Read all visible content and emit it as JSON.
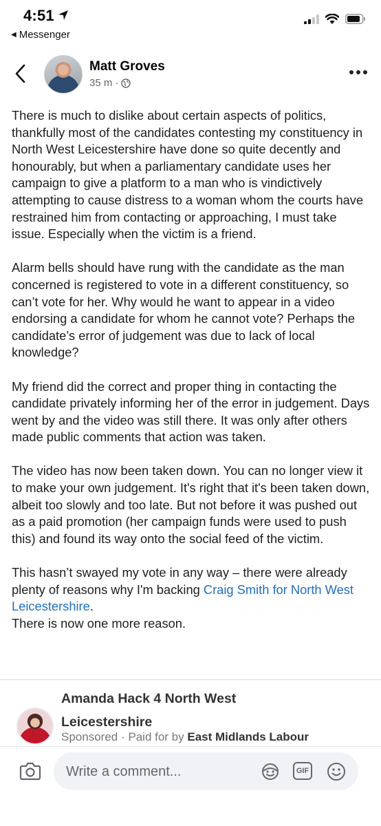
{
  "status_bar": {
    "time": "4:51",
    "back_app": "Messenger"
  },
  "post": {
    "author": "Matt Groves",
    "time": "35 m",
    "separator": "·",
    "paragraphs": [
      "There is much to dislike about certain aspects of politics, thankfully most of the candidates contesting my constituency in North West Leicestershire have done so quite decently and honourably, but when a parliamentary candidate uses her campaign to give a platform to a man who is vindictively attempting to cause distress to a woman whom the courts have restrained him from contacting or approaching, I must take issue. Especially when the victim is a friend.",
      "Alarm bells should have rung with the candidate as the man concerned is registered to vote in a different constituency, so can’t vote for her. Why would he want to appear in a video endorsing a candidate for whom he cannot vote? Perhaps the candidate’s error of judgement was due to lack of local knowledge?",
      "My friend did the correct and proper thing in contacting the candidate privately informing her of the error in judgement. Days went by and the video was still there. It was only after others made public comments that action was taken.",
      "The video has now been taken down. You can no longer view it to make your own judgement. It's right that it's been taken down, albeit too slowly and too late. But not before it was pushed out as a paid promotion (her campaign funds were used to push this) and found its way onto the social feed of the victim."
    ],
    "last_para_before": "This hasn’t swayed my vote in any way – there were already plenty of reasons why I'm backing ",
    "last_para_link": "Craig Smith for North West Leicestershire",
    "last_para_after": ".",
    "closing_line": "There is now one more reason."
  },
  "sponsored": {
    "page_name": "Amanda Hack 4 North West Leicestershire",
    "label": "Sponsored",
    "separator": "·",
    "paid_for_prefix": "Paid for by",
    "funder": "East Midlands Labour"
  },
  "comment_bar": {
    "placeholder": "Write a comment...",
    "gif_label": "GIF"
  },
  "icons": {
    "location": "location-arrow-icon",
    "signal": "signal-icon",
    "wifi": "wifi-icon",
    "battery": "battery-icon",
    "back": "chevron-left-icon",
    "globe": "globe-icon",
    "more": "more-horizontal-icon",
    "camera": "camera-icon",
    "avatar_sticker": "avatar-sticker-icon",
    "gif": "gif-icon",
    "emoji": "emoji-icon"
  },
  "colors": {
    "link": "#1f6fc1",
    "secondary_text": "#65676b",
    "input_bg": "#f0f2f5"
  }
}
